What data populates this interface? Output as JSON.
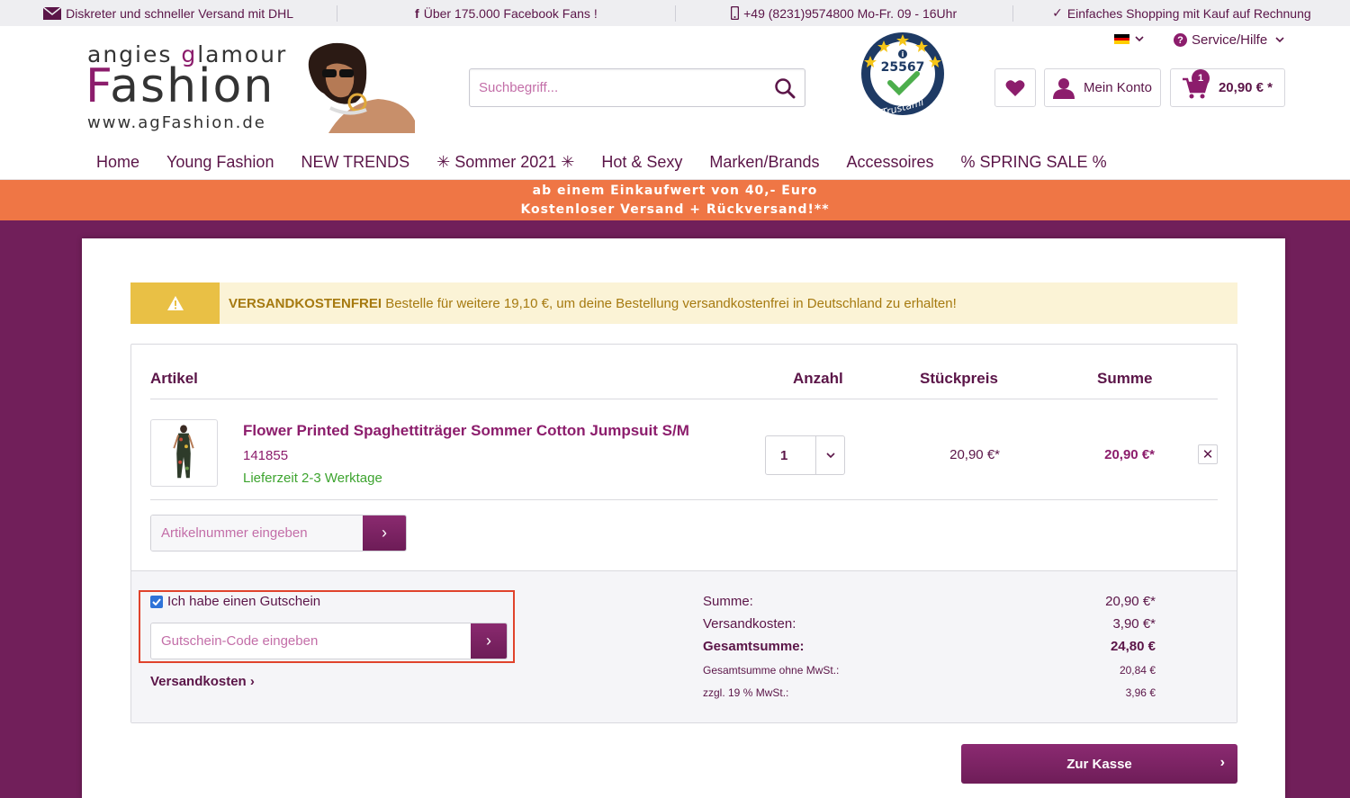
{
  "topbar": {
    "shipping": "Diskreter und schneller Versand mit DHL",
    "facebook": "Über 175.000 Facebook Fans !",
    "phone": "+49 (8231)9574800 Mo-Fr. 09 - 16Uhr",
    "invoice": "Einfaches Shopping mit Kauf auf Rechnung"
  },
  "logo": {
    "line1_a": "angies ",
    "line1_b": "g",
    "line1_c": "lamour",
    "line2_a": "F",
    "line2_b": "ashion",
    "line3": "www.agFashion.de"
  },
  "search": {
    "placeholder": "Suchbegriff..."
  },
  "trust": {
    "count": "25567",
    "label": "Trustami"
  },
  "service": {
    "label": "Service/Hilfe"
  },
  "header": {
    "account_label": "Mein Konto",
    "cart_total": "20,90 € *",
    "cart_count": "1"
  },
  "nav": {
    "items": [
      "Home",
      "Young Fashion",
      "NEW TRENDS",
      "✳ Sommer 2021 ✳",
      "Hot & Sexy",
      "Marken/Brands",
      "Accessoires",
      "% SPRING SALE %"
    ]
  },
  "promo": {
    "line1": "ab einem Einkaufwert von 40,- Euro",
    "line2": "Kostenloser Versand + Rückversand!**"
  },
  "alert": {
    "bold": "VERSANDKOSTENFREI",
    "text": " Bestelle für weitere 19,10 €, um deine Bestellung versandkostenfrei in Deutschland zu erhalten!"
  },
  "table": {
    "headers": {
      "article": "Artikel",
      "qty": "Anzahl",
      "unit": "Stückpreis",
      "sum": "Summe"
    }
  },
  "item": {
    "name": "Flower Printed Spaghettiträger Sommer Cotton Jumpsuit S/M",
    "sku": "141855",
    "delivery": "Lieferzeit 2-3 Werktage",
    "qty": "1",
    "unit_price": "20,90 €*",
    "total": "20,90 €*",
    "remove": "✕"
  },
  "sku_input": {
    "placeholder": "Artikelnummer eingeben"
  },
  "voucher": {
    "checkbox_label": "Ich habe einen Gutschein",
    "placeholder": "Gutschein-Code eingeben",
    "shipping_link": "Versandkosten"
  },
  "summary": {
    "rows": [
      {
        "label": "Summe:",
        "value": "20,90 €*"
      },
      {
        "label": "Versandkosten:",
        "value": "3,90 €*"
      },
      {
        "label": "Gesamtsumme:",
        "value": "24,80 €"
      },
      {
        "label": "Gesamtsumme ohne MwSt.:",
        "value": "20,84 €"
      },
      {
        "label": "zzgl. 19 % MwSt.:",
        "value": "3,96 €"
      }
    ]
  },
  "checkout": {
    "label": "Zur Kasse"
  },
  "colors": {
    "brand": "#8c1d6c",
    "brand_dark": "#5b1548",
    "promo": "#ef7645",
    "alert_bg": "#fbf3d6",
    "alert_icon": "#e9c045",
    "success": "#3da42f",
    "highlight": "#e0432c"
  }
}
